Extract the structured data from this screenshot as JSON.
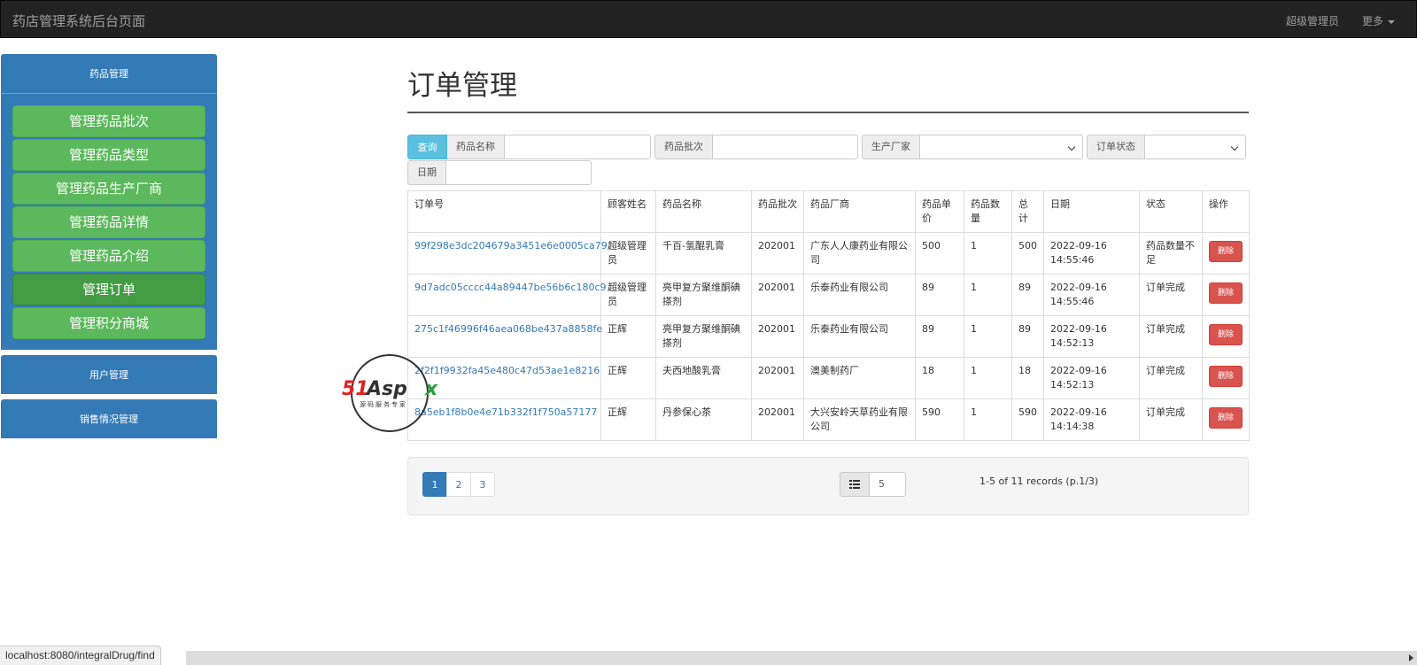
{
  "navbar": {
    "brand": "药店管理系统后台页面",
    "user": "超级管理员",
    "more": "更多"
  },
  "sidebar": {
    "drug_panel_title": "药品管理",
    "items": [
      {
        "label": "管理药品批次",
        "active": false
      },
      {
        "label": "管理药品类型",
        "active": false
      },
      {
        "label": "管理药品生产厂商",
        "active": false
      },
      {
        "label": "管理药品详情",
        "active": false
      },
      {
        "label": "管理药品介绍",
        "active": false
      },
      {
        "label": "管理订单",
        "active": true
      },
      {
        "label": "管理积分商城",
        "active": false
      }
    ],
    "user_panel_title": "用户管理",
    "sales_panel_title": "销售情况管理"
  },
  "main": {
    "title": "订单管理",
    "filters": {
      "query_label": "查询",
      "drug_name_label": "药品名称",
      "drug_name_value": "",
      "batch_label": "药品批次",
      "batch_value": "",
      "manufacturer_label": "生产厂家",
      "manufacturer_value": "",
      "status_label": "订单状态",
      "status_value": "",
      "date_label": "日期",
      "date_value": ""
    },
    "table": {
      "headers": [
        "订单号",
        "顾客姓名",
        "药品名称",
        "药品批次",
        "药品厂商",
        "药品单价",
        "药品数量",
        "总计",
        "日期",
        "状态",
        "操作"
      ],
      "rows": [
        {
          "order_id": "99f298e3dc204679a3451e6e0005ca79",
          "customer": "超级管理员",
          "drug": "千百-氢醌乳膏",
          "batch": "202001",
          "maker": "广东人人康药业有限公司",
          "price": "500",
          "qty": "1",
          "total": "500",
          "date": "2022-09-16 14:55:46",
          "status": "药品数量不足",
          "action": "删除"
        },
        {
          "order_id": "9d7adc05cccc44a89447be56b6c180c9",
          "customer": "超级管理员",
          "drug": "亮甲复方聚维酮碘搽剂",
          "batch": "202001",
          "maker": "乐泰药业有限公司",
          "price": "89",
          "qty": "1",
          "total": "89",
          "date": "2022-09-16 14:55:46",
          "status": "订单完成",
          "action": "删除"
        },
        {
          "order_id": "275c1f46996f46aea068be437a8858fe",
          "customer": "正辉",
          "drug": "亮甲复方聚维酮碘搽剂",
          "batch": "202001",
          "maker": "乐泰药业有限公司",
          "price": "89",
          "qty": "1",
          "total": "89",
          "date": "2022-09-16 14:52:13",
          "status": "订单完成",
          "action": "删除"
        },
        {
          "order_id": "2f2f1f9932fa45e480c47d53ae1e8216",
          "customer": "正辉",
          "drug": "夫西地酸乳膏",
          "batch": "202001",
          "maker": "澳美制药厂",
          "price": "18",
          "qty": "1",
          "total": "18",
          "date": "2022-09-16 14:52:13",
          "status": "订单完成",
          "action": "删除"
        },
        {
          "order_id": "8a5eb1f8b0e4e71b332f1f750a57177",
          "customer": "正辉",
          "drug": "丹参保心茶",
          "batch": "202001",
          "maker": "大兴安岭天草药业有限公司",
          "price": "590",
          "qty": "1",
          "total": "590",
          "date": "2022-09-16 14:14:38",
          "status": "订单完成",
          "action": "删除"
        }
      ]
    },
    "pagination": {
      "pages": [
        "1",
        "2",
        "3"
      ],
      "current": "1",
      "page_size": "5",
      "records_text": "1-5 of 11 records (p.1/3)"
    }
  },
  "statusbar": {
    "url": "localhost:8080/integralDrug/find"
  },
  "watermark": {
    "logo": "51Aspx",
    "tagline": "源码服务专家"
  },
  "colors": {
    "primary": "#337ab7",
    "success": "#5cb85c",
    "success_active": "#449d44",
    "info": "#5bc0de",
    "danger": "#d9534f",
    "navbar": "#222222"
  }
}
